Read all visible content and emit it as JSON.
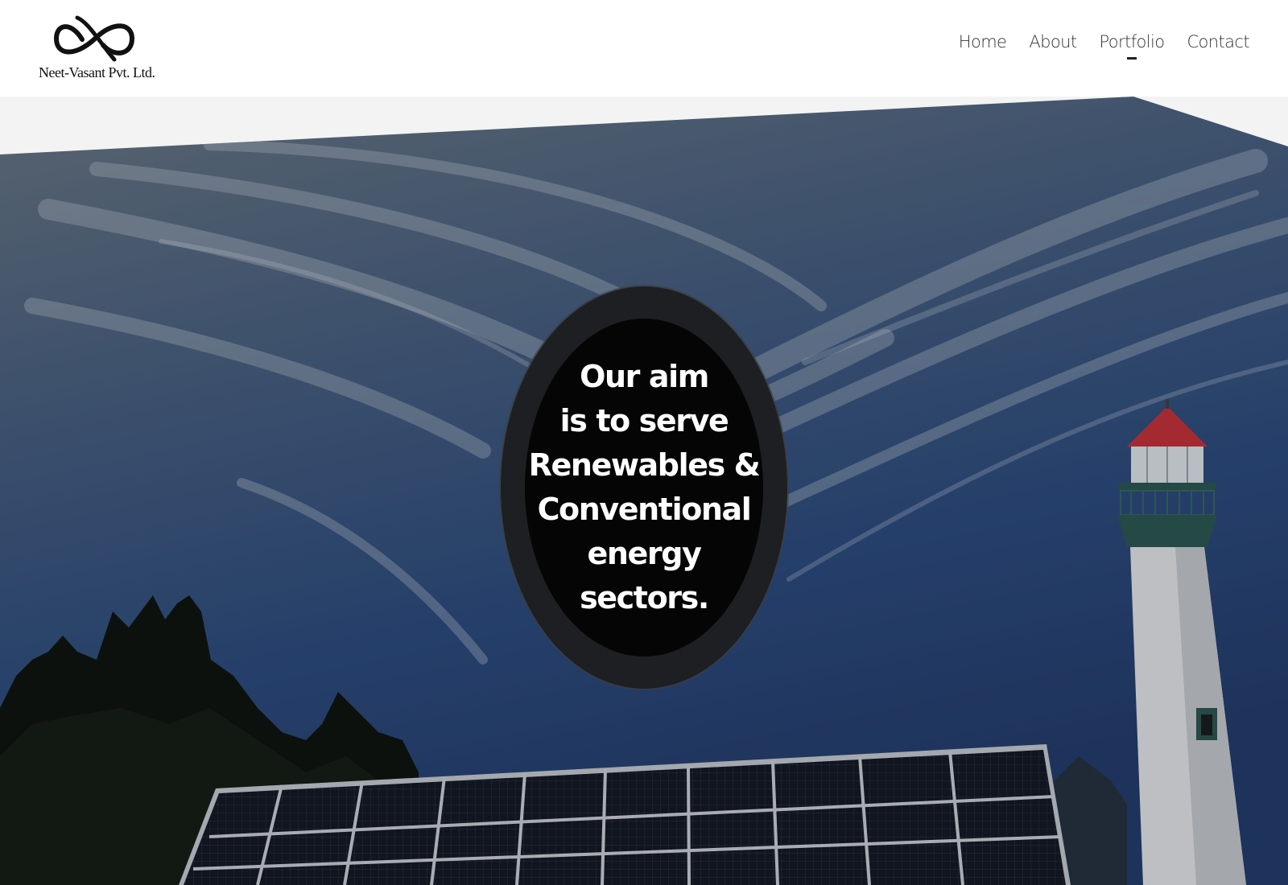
{
  "header": {
    "logo_text": "Neet-Vasant Pvt. Ltd.",
    "nav": [
      {
        "label": "Home",
        "active": false
      },
      {
        "label": "About",
        "active": false
      },
      {
        "label": "Portfolio",
        "active": true
      },
      {
        "label": "Contact",
        "active": false
      }
    ]
  },
  "hero": {
    "aim_lines": [
      "Our aim",
      "is to serve",
      "Renewables &",
      "Conventional",
      "energy",
      "sectors."
    ]
  },
  "colors": {
    "sky_top": "#5d6f82",
    "sky_bottom": "#24447a",
    "lighthouse_roof": "#c8343c",
    "circle_outer": "#1e1f22",
    "circle_inner": "#050505"
  }
}
